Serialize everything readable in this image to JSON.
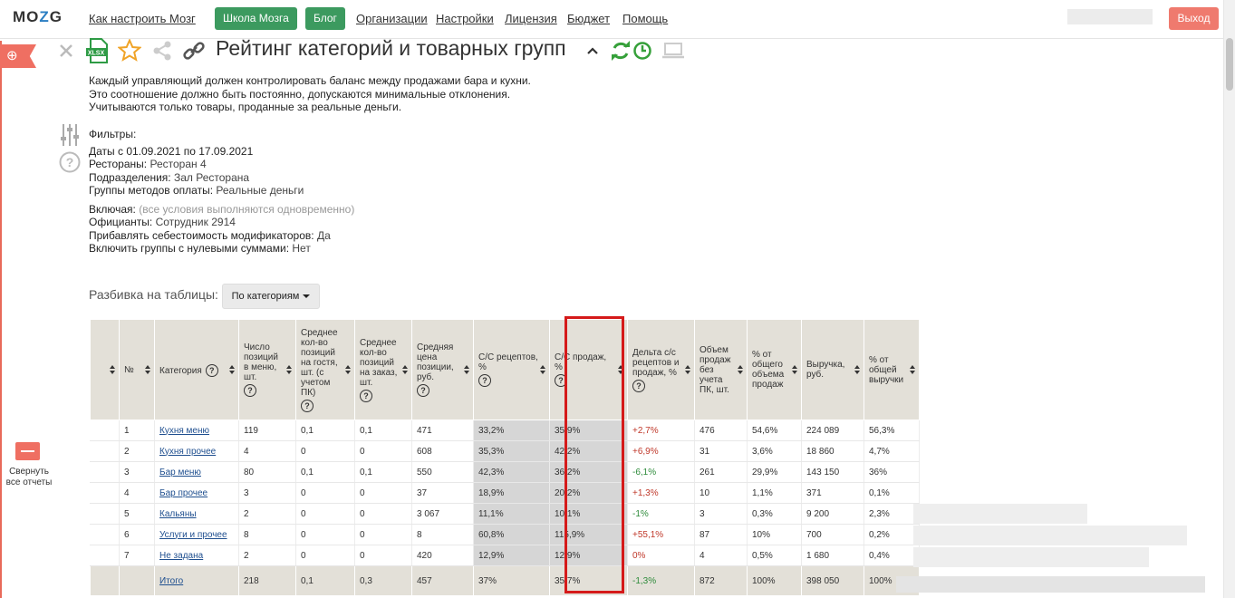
{
  "brand": {
    "logo": "MOZG"
  },
  "nav": {
    "how_to": "Как настроить Мозг",
    "school": "Школа Мозга",
    "blog": "Блог",
    "orgs": "Организации",
    "settings": "Настройки",
    "license": "Лицензия",
    "budget": "Бюджет",
    "help": "Помощь",
    "logout": "Выход"
  },
  "colors": {
    "accent_green": "#3c9a5f",
    "logout_red": "#ef7a6e",
    "highlight": "#d51a1a"
  },
  "toolbar": {
    "icons": [
      "close-icon",
      "xlsx-export-icon",
      "star-icon",
      "share-icon",
      "link-icon",
      "chevron-up-icon",
      "refresh-icon",
      "clock-icon",
      "laptop-icon"
    ],
    "xlsx_label": "XLSX"
  },
  "report": {
    "title": "Рейтинг категорий и товарных групп",
    "desc": [
      "Каждый управляющий должен контролировать баланс между продажами бара и кухни.",
      "Это соотношение должно быть постоянно, допускаются минимальные отклонения.",
      "Учитываются только товары, проданные за реальные деньги."
    ]
  },
  "filters": {
    "heading": "Фильтры:",
    "dates": "Даты с 01.09.2021 по 17.09.2021",
    "restaurants_label": "Рестораны:",
    "restaurants_value": "Ресторан 4",
    "divisions_label": "Подразделения:",
    "divisions_value": "Зал Ресторана",
    "payment_label": "Группы методов оплаты:",
    "payment_value": "Реальные деньги",
    "include_label": "Включая:",
    "include_note": "(все условия выполняются одновременно)",
    "waiters_label": "Официанты:",
    "waiters_value": "Сотрудник 2914",
    "modifiers_label": "Прибавлять себестоимость модификаторов:",
    "modifiers_value": "Да",
    "zero_label": "Включить группы с нулевыми суммами:",
    "zero_value": "Нет"
  },
  "breakdown": {
    "label": "Разбивка на таблицы:",
    "value": "По категориям"
  },
  "sidebar": {
    "collapse_label": "Свернуть все отчеты"
  },
  "table": {
    "headers": [
      {
        "label": "",
        "help": false
      },
      {
        "label": "№",
        "help": false
      },
      {
        "label": "Категория",
        "help": true
      },
      {
        "label": "Число позиций в меню, шт.",
        "help": true
      },
      {
        "label": "Среднее кол-во позиций на гостя, шт. (с учетом ПК)",
        "help": true
      },
      {
        "label": "Среднее кол-во позиций на заказ, шт.",
        "help": true
      },
      {
        "label": "Средняя цена позиции, руб.",
        "help": true
      },
      {
        "label": "С/С рецептов, %",
        "help": true
      },
      {
        "label": "С/С продаж, %",
        "help": true
      },
      {
        "label": "Дельта с/с рецептов и продаж, %",
        "help": true
      },
      {
        "label": "Объем продаж без учета ПК, шт.",
        "help": false
      },
      {
        "label": "% от общего объема продаж",
        "help": false
      },
      {
        "label": "Выручка, руб.",
        "help": false
      },
      {
        "label": "% от общей выручки",
        "help": false
      }
    ],
    "rows": [
      {
        "n": "1",
        "cat": "Кухня меню",
        "items": "119",
        "per_guest": "0,1",
        "per_order": "0,1",
        "avg_price": "471",
        "cc_recipe": "33,2%",
        "cc_sales": "35,9%",
        "delta": "+2,7%",
        "delta_sign": "pos",
        "volume": "476",
        "vol_pct": "54,6%",
        "revenue": "224 089",
        "rev_pct": "56,3%"
      },
      {
        "n": "2",
        "cat": "Кухня прочее",
        "items": "4",
        "per_guest": "0",
        "per_order": "0",
        "avg_price": "608",
        "cc_recipe": "35,3%",
        "cc_sales": "42,2%",
        "delta": "+6,9%",
        "delta_sign": "pos",
        "volume": "31",
        "vol_pct": "3,6%",
        "revenue": "18 860",
        "rev_pct": "4,7%"
      },
      {
        "n": "3",
        "cat": "Бар меню",
        "items": "80",
        "per_guest": "0,1",
        "per_order": "0,1",
        "avg_price": "550",
        "cc_recipe": "42,3%",
        "cc_sales": "36,2%",
        "delta": "-6,1%",
        "delta_sign": "neg",
        "volume": "261",
        "vol_pct": "29,9%",
        "revenue": "143 150",
        "rev_pct": "36%"
      },
      {
        "n": "4",
        "cat": "Бар прочее",
        "items": "3",
        "per_guest": "0",
        "per_order": "0",
        "avg_price": "37",
        "cc_recipe": "18,9%",
        "cc_sales": "20,2%",
        "delta": "+1,3%",
        "delta_sign": "pos",
        "volume": "10",
        "vol_pct": "1,1%",
        "revenue": "371",
        "rev_pct": "0,1%"
      },
      {
        "n": "5",
        "cat": "Кальяны",
        "items": "2",
        "per_guest": "0",
        "per_order": "0",
        "avg_price": "3 067",
        "cc_recipe": "11,1%",
        "cc_sales": "10,1%",
        "delta": "-1%",
        "delta_sign": "neg",
        "volume": "3",
        "vol_pct": "0,3%",
        "revenue": "9 200",
        "rev_pct": "2,3%"
      },
      {
        "n": "6",
        "cat": "Услуги и прочее",
        "items": "8",
        "per_guest": "0",
        "per_order": "0",
        "avg_price": "8",
        "cc_recipe": "60,8%",
        "cc_sales": "115,9%",
        "delta": "+55,1%",
        "delta_sign": "pos",
        "volume": "87",
        "vol_pct": "10%",
        "revenue": "700",
        "rev_pct": "0,2%"
      },
      {
        "n": "7",
        "cat": "Не задана",
        "items": "2",
        "per_guest": "0",
        "per_order": "0",
        "avg_price": "420",
        "cc_recipe": "12,9%",
        "cc_sales": "12,9%",
        "delta": "0%",
        "delta_sign": "pos",
        "volume": "4",
        "vol_pct": "0,5%",
        "revenue": "1 680",
        "rev_pct": "0,4%"
      }
    ],
    "total": {
      "n": "",
      "cat": "Итого",
      "items": "218",
      "per_guest": "0,1",
      "per_order": "0,3",
      "avg_price": "457",
      "cc_recipe": "37%",
      "cc_sales": "35,7%",
      "delta": "-1,3%",
      "delta_sign": "neg",
      "volume": "872",
      "vol_pct": "100%",
      "revenue": "398 050",
      "rev_pct": "100%"
    }
  }
}
